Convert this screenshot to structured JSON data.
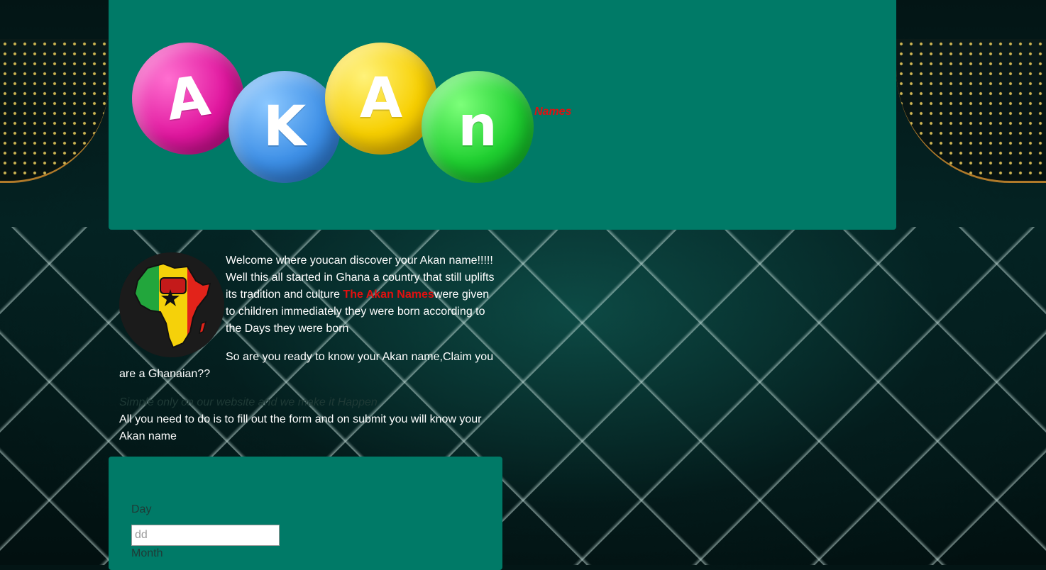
{
  "header": {
    "logo_letters": [
      "A",
      "K",
      "A",
      "n"
    ],
    "logo_suffix": "Names",
    "colors": {
      "panel": "#007a67",
      "accent_red": "#e11010"
    }
  },
  "intro": {
    "emblem_icon": "africa-fist-emblem-icon",
    "p1_before": "Welcome where youcan discover your Akan name!!!!! Well this all started in Ghana a country that still uplifts its tradition and culture ",
    "p1_highlight": "The Akan Names",
    "p1_after": "were given to children immediately they were born according to the Days they were born",
    "p2": "So are you ready to know your Akan name,Claim you are a Ghanaian??",
    "p3_muted": "Simple only on our website and we make it Happen",
    "p3": "All you need to do is to fill out the form and on submit you will know your Akan name"
  },
  "form": {
    "day_label": "Day",
    "day_placeholder": "dd",
    "month_label": "Month"
  }
}
